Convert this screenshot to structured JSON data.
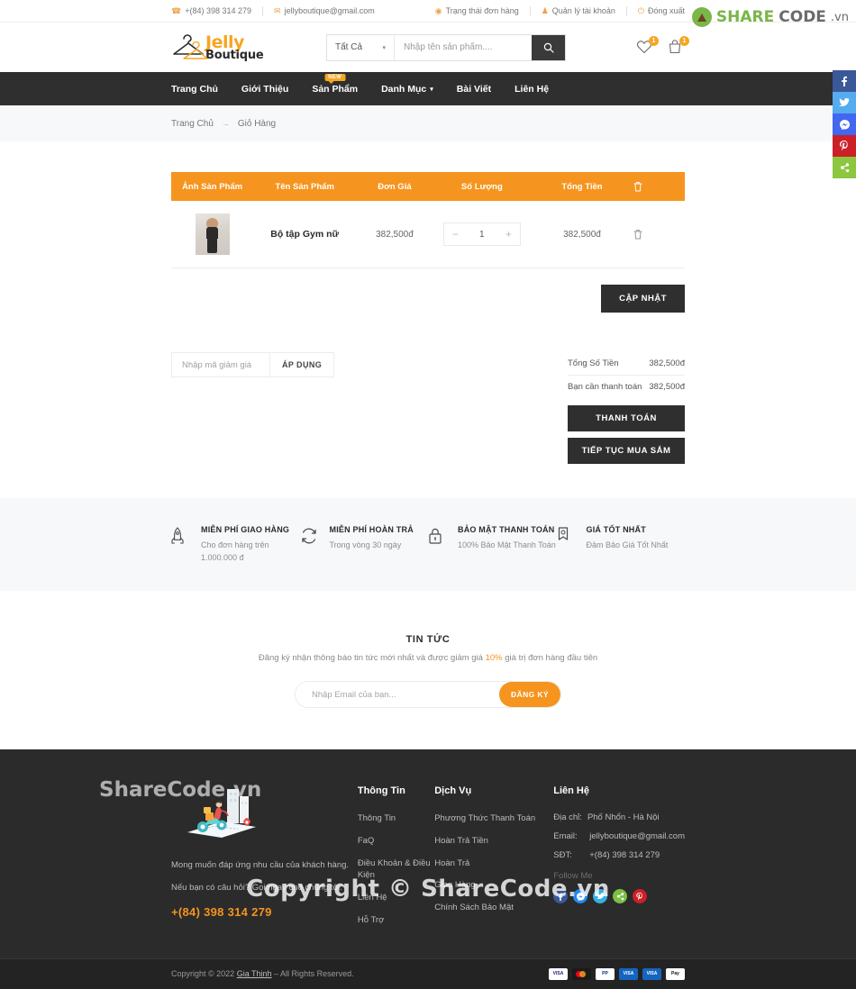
{
  "watermark": {
    "brand_share": "SHARE",
    "brand_code": "CODE",
    "brand_vn": ".vn",
    "footer_copy": "Copyright © ShareCode.vn",
    "footer_logo_text": "ShareCode.vn"
  },
  "topbar": {
    "phone": "+(84) 398 314 279",
    "email": "jellyboutique@gmail.com",
    "order_status": "Trạng thái đơn hàng",
    "account": "Quản lý tài khoản",
    "logout": "Đóng xuất"
  },
  "header": {
    "logo_primary": "Jelly",
    "logo_secondary": "Boutique",
    "search_category": "Tất Cả",
    "search_placeholder": "Nhập tên sản phẩm....",
    "search_value": "",
    "wishlist_count": "1",
    "cart_count": "1"
  },
  "nav": {
    "items": [
      {
        "label": "Trang Chủ",
        "badge": "",
        "caret": false
      },
      {
        "label": "Giới Thiệu",
        "badge": "",
        "caret": false
      },
      {
        "label": "Sản Phẩm",
        "badge": "NEW",
        "caret": false
      },
      {
        "label": "Danh Mục",
        "badge": "",
        "caret": true
      },
      {
        "label": "Bài Viết",
        "badge": "",
        "caret": false
      },
      {
        "label": "Liên Hệ",
        "badge": "",
        "caret": false
      }
    ]
  },
  "breadcrumb": {
    "home": "Trang Chủ",
    "arrow": "→",
    "current": "Giỏ Hàng"
  },
  "cart": {
    "headers": [
      "Ảnh Sản Phẩm",
      "Tên Sản Phẩm",
      "Đơn Giá",
      "Số Lượng",
      "Tổng Tiền",
      "trash-icon"
    ],
    "rows": [
      {
        "name": "Bộ tập Gym nữ",
        "unit_price": "382,500đ",
        "qty_minus": "−",
        "qty": "1",
        "qty_plus": "+",
        "total": "382,500đ"
      }
    ],
    "update_button": "CẬP NHẬT"
  },
  "coupon": {
    "placeholder": "Nhập mã giảm giá",
    "value": "",
    "apply_button": "ÁP DỤNG"
  },
  "totals": {
    "subtotal_label": "Tổng Số Tiền",
    "subtotal_value": "382,500đ",
    "payable_label": "Bạn cần thanh toán",
    "payable_value": "382,500đ",
    "checkout_button": "THANH TOÁN",
    "continue_button": "TIẾP TỤC MUA SẮM"
  },
  "features": [
    {
      "icon": "rocket-icon",
      "title": "MIỄN PHÍ GIAO HÀNG",
      "desc": "Cho đơn hàng trên 1.000.000 đ"
    },
    {
      "icon": "refresh-icon",
      "title": "MIỄN PHÍ HOÀN TRẢ",
      "desc": "Trong vòng 30 ngày"
    },
    {
      "icon": "lock-icon",
      "title": "BẢO MẬT THANH TOÁN",
      "desc": "100% Bảo Mật Thanh Toán"
    },
    {
      "icon": "medal-icon",
      "title": "GIÁ TỐT NHẤT",
      "desc": "Đảm Bảo Giá Tốt Nhất"
    }
  ],
  "newsletter": {
    "title": "TIN TỨC",
    "sub_before": "Đăng ký nhận thông báo tin tức mới nhất và được giảm giá ",
    "highlight": "10%",
    "sub_after": " giá trị đơn hàng đầu tiên",
    "placeholder": "Nhập Email của bạn...",
    "value": "",
    "button": "ĐĂNG KÝ"
  },
  "footer": {
    "tagline_1": "Mong muốn đáp ứng nhu cầu của khách hàng.",
    "tagline_2": "Nếu bạn có câu hỏi? Gọi ngay cho chúng tôi.",
    "phone": "+(84) 398 314 279",
    "col_info_title": "Thông Tin",
    "col_info_links": [
      "Thông Tin",
      "FaQ",
      "Điều Khoản & Điều Kiện",
      "Liên Hệ",
      "Hỗ Trợ"
    ],
    "col_service_title": "Dịch Vụ",
    "col_service_links": [
      "Phương Thức Thanh Toán",
      "Hoàn Trả Tiền",
      "Hoàn Trả",
      "Giao Hàng",
      "Chính Sách Bảo Mật"
    ],
    "col_contact_title": "Liên Hệ",
    "address_label": "Địa chỉ:",
    "address_value": "Phố Nhổn - Hà Nội",
    "email_label": "Email:",
    "email_value": "jellyboutique@gmail.com",
    "phone_label": "SĐT:",
    "phone_value": "+(84) 398 314 279",
    "follow_label": "Follow Me",
    "socials": [
      {
        "name": "facebook-icon",
        "glyph": "f",
        "color": "#3b5998"
      },
      {
        "name": "messenger-icon",
        "glyph": "✆",
        "color": "#2389f5"
      },
      {
        "name": "twitter-icon",
        "glyph": "🐦",
        "color": "#38b0e3"
      },
      {
        "name": "share-icon",
        "glyph": "<",
        "color": "#7ac143"
      },
      {
        "name": "pinterest-icon",
        "glyph": "ⓟ",
        "color": "#cb2027"
      }
    ]
  },
  "footbar": {
    "copyright_pre": "Copyright © 2022 ",
    "copyright_link": "Gia Thịnh",
    "copyright_post": " – All Rights Reserved.",
    "payments": [
      {
        "name": "visa",
        "label": "VISA",
        "bg": "#ffffff",
        "fg": "#1a1f71"
      },
      {
        "name": "mastercard",
        "label": "",
        "bg": "#1a1a1a",
        "fg": "#ffffff"
      },
      {
        "name": "paypal",
        "label": "PP",
        "bg": "#ffffff",
        "fg": "#003087"
      },
      {
        "name": "maestro",
        "label": "VISA",
        "bg": "#1565c0",
        "fg": "#ffffff"
      },
      {
        "name": "visa-electron",
        "label": "VISA",
        "bg": "#1565c0",
        "fg": "#ffffff"
      },
      {
        "name": "applepay",
        "label": "Pay",
        "bg": "#ffffff",
        "fg": "#111111"
      }
    ]
  },
  "rail": [
    {
      "name": "facebook-share",
      "glyph": "f",
      "color": "#3b5998"
    },
    {
      "name": "twitter-share",
      "glyph": "t",
      "color": "#55acee"
    },
    {
      "name": "messenger-share",
      "glyph": "✆",
      "color": "#4267f0"
    },
    {
      "name": "pinterest-share",
      "glyph": "ⓟ",
      "color": "#cb2027"
    },
    {
      "name": "more-share",
      "glyph": "<",
      "color": "#8dc63f"
    }
  ]
}
